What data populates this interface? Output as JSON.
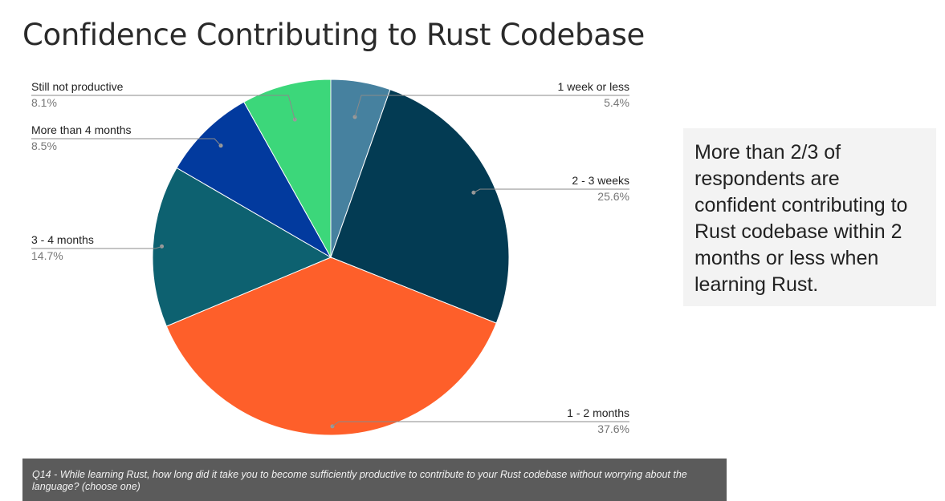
{
  "page": {
    "title": "Confidence Contributing to Rust Codebase",
    "callout": "More than 2/3 of respondents are confident contributing to Rust codebase within 2 months or less when learning Rust.",
    "footnote": "Q14 - While learning Rust, how long did it take you to become sufficiently productive to contribute to your Rust codebase without worrying about the language? (choose one)"
  },
  "chart_data": {
    "type": "pie",
    "title": "Confidence Contributing to Rust Codebase",
    "start": "12 o'clock, clockwise",
    "legend": "none (labels beside slices with leader lines)",
    "slices": [
      {
        "label": "1 week or less",
        "value": 5.4,
        "pct_label": "5.4%",
        "color": "#46819f"
      },
      {
        "label": "2 - 3 weeks",
        "value": 25.6,
        "pct_label": "25.6%",
        "color": "#033b53"
      },
      {
        "label": "1 - 2 months",
        "value": 37.6,
        "pct_label": "37.6%",
        "color": "#fe5f2a"
      },
      {
        "label": "3 - 4 months",
        "value": 14.7,
        "pct_label": "14.7%",
        "color": "#0d6170"
      },
      {
        "label": "More than 4 months",
        "value": 8.5,
        "pct_label": "8.5%",
        "color": "#023a9e"
      },
      {
        "label": "Still not productive",
        "value": 8.1,
        "pct_label": "8.1%",
        "color": "#3cd77a"
      }
    ]
  }
}
